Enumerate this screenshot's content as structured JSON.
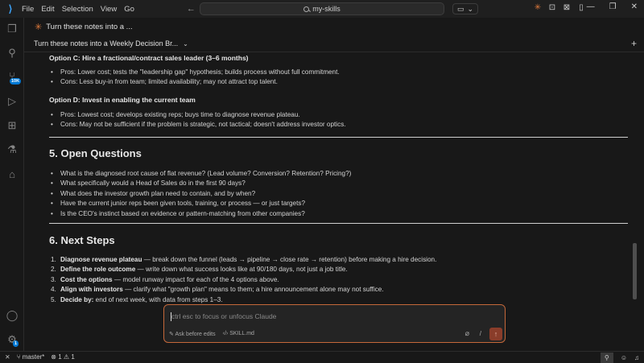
{
  "titlebar": {
    "menu": [
      "File",
      "Edit",
      "Selection",
      "View",
      "Go"
    ],
    "search": "my-skills"
  },
  "activity": {
    "scm_badge": "10K",
    "settings_badge": "1"
  },
  "tabs": {
    "primary": "Turn these notes into a ...",
    "secondary": "Turn these notes into a Weekly Decision Br..."
  },
  "document": {
    "optionC": {
      "title": "Option C: Hire a fractional/contract sales leader (3–6 months)",
      "pros": "Pros: Lower cost; tests the \"leadership gap\" hypothesis; builds process without full commitment.",
      "cons": "Cons: Less buy-in from team; limited availability; may not attract top talent."
    },
    "optionD": {
      "title": "Option D: Invest in enabling the current team",
      "pros": "Pros: Lowest cost; develops existing reps; buys time to diagnose revenue plateau.",
      "cons": "Cons: May not be sufficient if the problem is strategic, not tactical; doesn't address investor optics."
    },
    "open_questions": {
      "heading": "5. Open Questions",
      "items": [
        "What is the diagnosed root cause of flat revenue? (Lead volume? Conversion? Retention? Pricing?)",
        "What specifically would a Head of Sales do in the first 90 days?",
        "What does the investor growth plan need to contain, and by when?",
        "Have the current junior reps been given tools, training, or process — or just targets?",
        "Is the CEO's instinct based on evidence or pattern-matching from other companies?"
      ]
    },
    "next_steps": {
      "heading": "6. Next Steps",
      "items": [
        {
          "num": "1.",
          "bold": "Diagnose revenue plateau",
          "rest": " — break down the funnel (leads → pipeline → close rate → retention) before making a hire decision."
        },
        {
          "num": "2.",
          "bold": "Define the role outcome",
          "rest": " — write down what success looks like at 90/180 days, not just a job title."
        },
        {
          "num": "3.",
          "bold": "Cost the options",
          "rest": " — model runway impact for each of the 4 options above."
        },
        {
          "num": "4.",
          "bold": "Align with investors",
          "rest": " — clarify what \"growth plan\" means to them; a hire announcement alone may not suffice."
        },
        {
          "num": "5.",
          "bold": "Decide by:",
          "rest": " end of next week, with data from steps 1–3."
        }
      ]
    }
  },
  "input": {
    "placeholder": "ctrl esc to focus or unfocus Claude",
    "mode": "Ask before edits",
    "file": "SKILL.md",
    "slash": "/"
  },
  "statusbar": {
    "branch": "master*",
    "errors": "1",
    "warnings": "1"
  }
}
